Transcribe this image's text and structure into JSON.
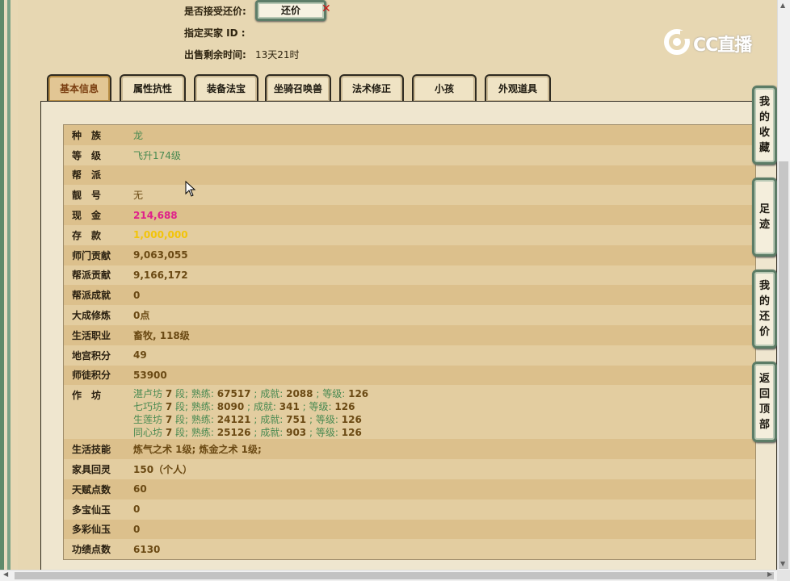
{
  "top_info": {
    "accept_counter_label": "是否接受还价:",
    "counter_button": "还价",
    "buyer_id_label": "指定买家 ID :",
    "time_left_label": "出售剩余时间:",
    "time_left_value": "13天21时"
  },
  "logo": {
    "text": "CC直播"
  },
  "tabs": [
    "基本信息",
    "属性抗性",
    "装备法宝",
    "坐骑召唤兽",
    "法术修正",
    "小孩",
    "外观道具"
  ],
  "rows": {
    "race": {
      "label": "种　族",
      "value": "龙"
    },
    "level": {
      "label": "等　级",
      "value": "飞升174级"
    },
    "guild": {
      "label": "帮　派",
      "value": ""
    },
    "title": {
      "label": "靓　号",
      "value": "无"
    },
    "cash": {
      "label": "现　金",
      "value": "214,688"
    },
    "savings": {
      "label": "存　款",
      "value": "1,000,000"
    },
    "sect_contrib": {
      "label": "师门贡献",
      "value": "9,063,055"
    },
    "guild_contrib": {
      "label": "帮派贡献",
      "value": "9,166,172"
    },
    "guild_achv": {
      "label": "帮派成就",
      "value": "0"
    },
    "cultivation": {
      "label": "大成修炼",
      "value": "0点"
    },
    "life_job": {
      "label": "生活职业",
      "value": "畜牧, 118级"
    },
    "palace_points": {
      "label": "地宫积分",
      "value": "49"
    },
    "mentor_points": {
      "label": "师徒积分",
      "value": "53900"
    },
    "workshop": {
      "label": "作　坊",
      "lines": [
        {
          "name": "湛卢坊",
          "stage": "7",
          "skill": "67517",
          "achv": "2088",
          "lvl": "126"
        },
        {
          "name": "七巧坊",
          "stage": "7",
          "skill": "8090",
          "achv": "341",
          "lvl": "126"
        },
        {
          "name": "生莲坊",
          "stage": "7",
          "skill": "24121",
          "achv": "751",
          "lvl": "126"
        },
        {
          "name": "同心坊",
          "stage": "7",
          "skill": "25126",
          "achv": "903",
          "lvl": "126"
        }
      ],
      "word_stage": "段;",
      "word_skill": "熟练:",
      "word_achv": "成就:",
      "word_lvl": "等级:"
    },
    "life_skill": {
      "label": "生活技能",
      "value": "炼气之术 1级; 炼金之术 1级;"
    },
    "furniture": {
      "label": "家具回灵",
      "value": "150（个人）"
    },
    "talent": {
      "label": "天赋点数",
      "value": "60"
    },
    "duobao": {
      "label": "多宝仙玉",
      "value": "0"
    },
    "duocai": {
      "label": "多彩仙玉",
      "value": "0"
    },
    "merit": {
      "label": "功绩点数",
      "value": "6130"
    }
  },
  "side_buttons": {
    "favorites": [
      "我",
      "的",
      "收",
      "藏"
    ],
    "footprint": [
      "足",
      "迹"
    ],
    "my_counter": [
      "我",
      "的",
      "还",
      "价"
    ],
    "back_top": [
      "返",
      "回",
      "顶",
      "部"
    ]
  },
  "colors": {
    "green_text": "#4a8a52",
    "cash_pink": "#e0208a",
    "savings_gold": "#f2c40a",
    "value_brown": "#6b4a14"
  }
}
